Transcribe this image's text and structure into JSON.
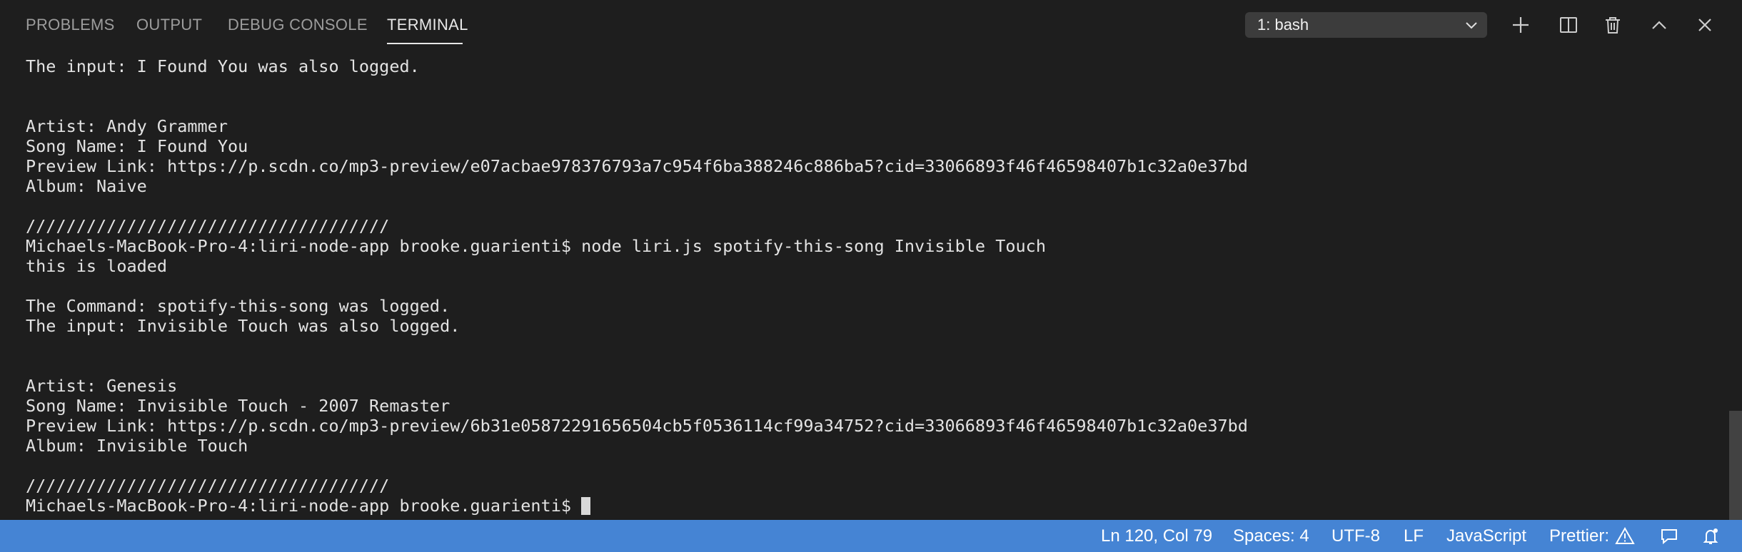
{
  "tabs": [
    {
      "label": "PROBLEMS"
    },
    {
      "label": "OUTPUT"
    },
    {
      "label": "DEBUG CONSOLE"
    },
    {
      "label": "TERMINAL",
      "active": true
    }
  ],
  "terminal_selector": {
    "value": "1: bash"
  },
  "toolbar_icons": [
    "plus-icon",
    "split-icon",
    "trash-icon",
    "chevron-up-icon",
    "close-icon"
  ],
  "terminal": {
    "lines": [
      "The input: I Found You was also logged.",
      "",
      "",
      "Artist: Andy Grammer",
      "Song Name: I Found You",
      "Preview Link: https://p.scdn.co/mp3-preview/e07acbae978376793a7c954f6ba388246c886ba5?cid=33066893f46f46598407b1c32a0e37bd",
      "Album: Naive",
      "",
      "////////////////////////////////////",
      "Michaels-MacBook-Pro-4:liri-node-app brooke.guarienti$ node liri.js spotify-this-song Invisible Touch",
      "this is loaded",
      "",
      "The Command: spotify-this-song was logged.",
      "The input: Invisible Touch was also logged.",
      "",
      "",
      "Artist: Genesis",
      "Song Name: Invisible Touch - 2007 Remaster",
      "Preview Link: https://p.scdn.co/mp3-preview/6b31e05872291656504cb5f0536114cf99a34752?cid=33066893f46f46598407b1c32a0e37bd",
      "Album: Invisible Touch",
      "",
      "////////////////////////////////////"
    ],
    "prompt": "Michaels-MacBook-Pro-4:liri-node-app brooke.guarienti$"
  },
  "statusbar": {
    "position": "Ln 120, Col 79",
    "spaces": "Spaces: 4",
    "encoding": "UTF-8",
    "eol": "LF",
    "language": "JavaScript",
    "prettier": "Prettier:"
  },
  "colors": {
    "background": "#1e1e1e",
    "statusbar": "#4584d4",
    "text": "#e3e3e3"
  }
}
